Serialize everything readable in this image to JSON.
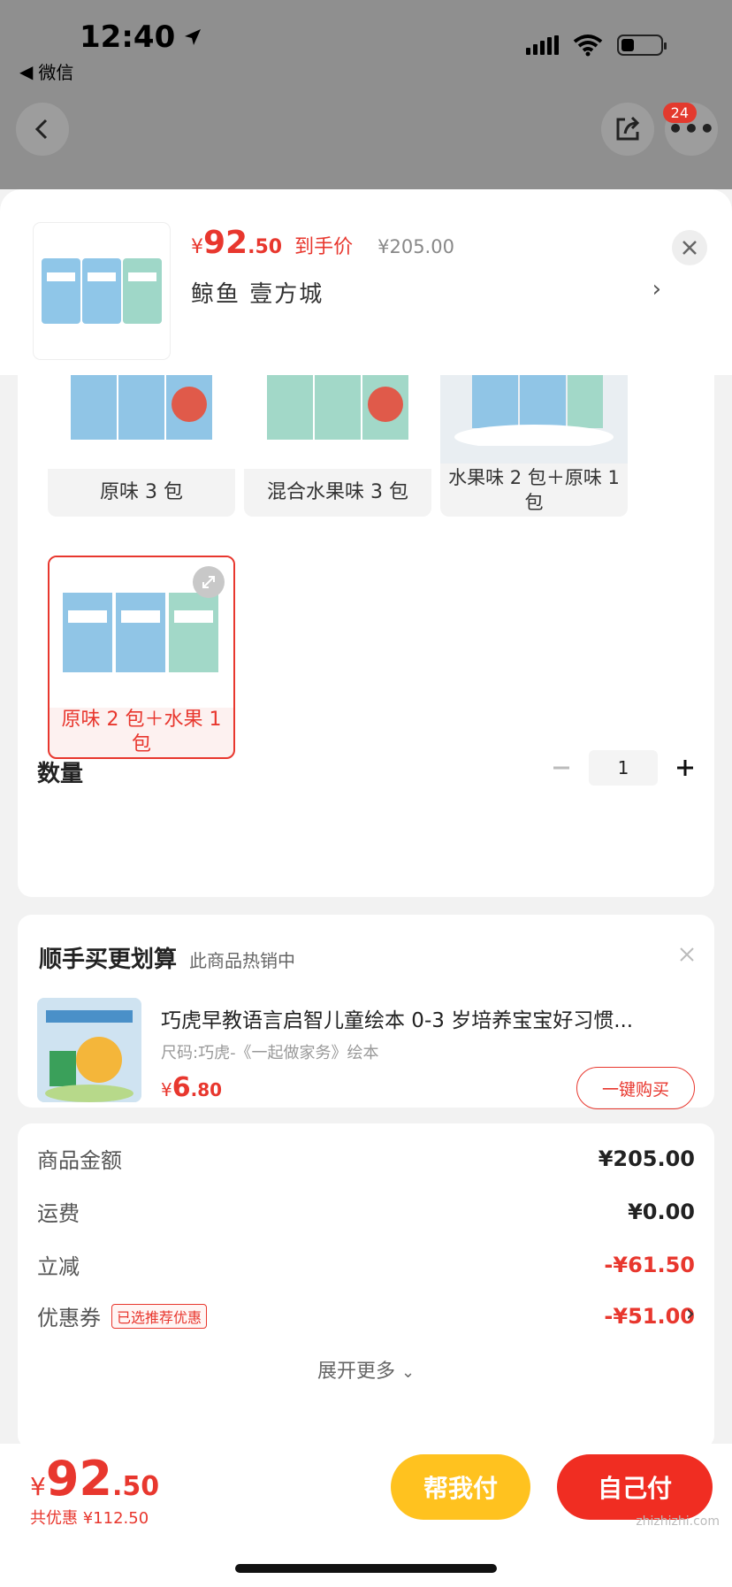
{
  "status": {
    "time": "12:40",
    "back_app": "微信"
  },
  "nav": {
    "badge": "24"
  },
  "product": {
    "price_symbol": "¥",
    "price_int": "92",
    "price_dec": ".50",
    "price_label": "到手价",
    "original_price": "¥205.00",
    "shop": "鲸鱼 壹方城"
  },
  "variants": [
    {
      "label": "原味 3 包"
    },
    {
      "label": "混合水果味 3 包"
    },
    {
      "label": "水果味 2 包＋原味 1 包"
    },
    {
      "label": "原味 2 包＋水果 1 包"
    }
  ],
  "quantity": {
    "label": "数量",
    "value": "1"
  },
  "recommend": {
    "title": "顺手买更划算",
    "subtitle": "此商品热销中",
    "name": "巧虎早教语言启智儿童绘本 0-3 岁培养宝宝好习惯...",
    "spec": "尺码:巧虎-《一起做家务》绘本",
    "price_symbol": "¥",
    "price_int": "6",
    "price_dec": ".80",
    "buy_label": "一键购买"
  },
  "summary": {
    "rows": [
      {
        "label": "商品金额",
        "value": "¥205.00"
      },
      {
        "label": "运费",
        "value": "¥0.00"
      },
      {
        "label": "立减",
        "value": "-¥61.50"
      },
      {
        "label": "优惠券",
        "tag": "已选推荐优惠",
        "value": "-¥51.00"
      }
    ],
    "more": "展开更多"
  },
  "footer": {
    "price_symbol": "¥",
    "price_int": "92",
    "price_dec": ".50",
    "saved": "共优惠 ¥112.50",
    "help_pay": "帮我付",
    "self_pay": "自己付"
  },
  "watermark": "zhizhizhi.com",
  "colors": {
    "accent": "#e8372e",
    "help_button": "#ffc21f",
    "pay_button": "#f02d22"
  }
}
